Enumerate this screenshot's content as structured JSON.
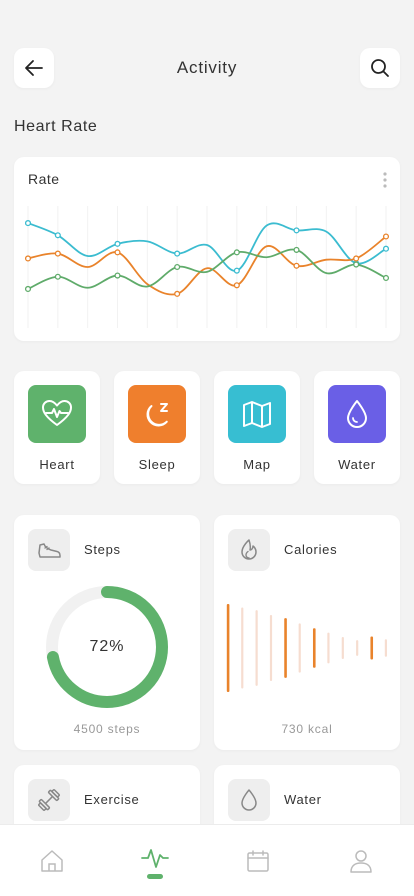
{
  "header": {
    "title": "Activity",
    "back_icon": "arrow-left-icon",
    "search_icon": "search-icon"
  },
  "section": {
    "title": "Heart Rate"
  },
  "chart_card": {
    "label": "Rate"
  },
  "chart_data": {
    "type": "line",
    "title": "Rate",
    "xlabel": "",
    "ylabel": "",
    "x": [
      0,
      1,
      2,
      3,
      4,
      5,
      6,
      7,
      8,
      9,
      10,
      11,
      12
    ],
    "series": [
      {
        "color": "#3bbcd0",
        "values": [
          86,
          76,
          59,
          69,
          71,
          61,
          68,
          47,
          84,
          80,
          79,
          53,
          65
        ]
      },
      {
        "color": "#e9832b",
        "values": [
          57,
          61,
          50,
          62,
          36,
          28,
          49,
          35,
          67,
          51,
          56,
          57,
          75
        ]
      },
      {
        "color": "#5fab6a",
        "values": [
          32,
          42,
          33,
          43,
          34,
          50,
          46,
          62,
          58,
          64,
          45,
          52,
          41
        ]
      }
    ],
    "ylim": [
      0,
      100
    ],
    "grid": "vertical"
  },
  "tiles": [
    {
      "label": "Heart",
      "color": "#5fb26c",
      "icon": "heart-pulse-icon"
    },
    {
      "label": "Sleep",
      "color": "#ef7f2d",
      "icon": "moon-icon"
    },
    {
      "label": "Map",
      "color": "#37bed2",
      "icon": "map-icon"
    },
    {
      "label": "Water",
      "color": "#6a5fe6",
      "icon": "water-drop-icon"
    }
  ],
  "steps": {
    "title": "Steps",
    "icon": "shoe-icon",
    "percent_text": "72%",
    "percent": 72,
    "footer": "4500 steps",
    "color": "#5fb26c"
  },
  "calories": {
    "title": "Calories",
    "icon": "flame-icon",
    "footer": "730 kcal",
    "color": "#e9832b",
    "bars": [
      {
        "value": 1.0,
        "strong": true
      },
      {
        "value": 0.92,
        "strong": false
      },
      {
        "value": 0.86,
        "strong": false
      },
      {
        "value": 0.75,
        "strong": false
      },
      {
        "value": 0.68,
        "strong": true
      },
      {
        "value": 0.56,
        "strong": false
      },
      {
        "value": 0.45,
        "strong": true
      },
      {
        "value": 0.35,
        "strong": false
      },
      {
        "value": 0.25,
        "strong": false
      },
      {
        "value": 0.18,
        "strong": false
      },
      {
        "value": 0.26,
        "strong": true
      },
      {
        "value": 0.2,
        "strong": false
      }
    ]
  },
  "exercise": {
    "title": "Exercise",
    "icon": "dumbbell-icon"
  },
  "water": {
    "title": "Water",
    "icon": "water-drop-icon"
  },
  "nav": {
    "items": [
      {
        "icon": "home-icon"
      },
      {
        "icon": "activity-icon",
        "active": true
      },
      {
        "icon": "calendar-icon"
      },
      {
        "icon": "user-icon"
      }
    ],
    "active_color": "#5fb26c"
  }
}
